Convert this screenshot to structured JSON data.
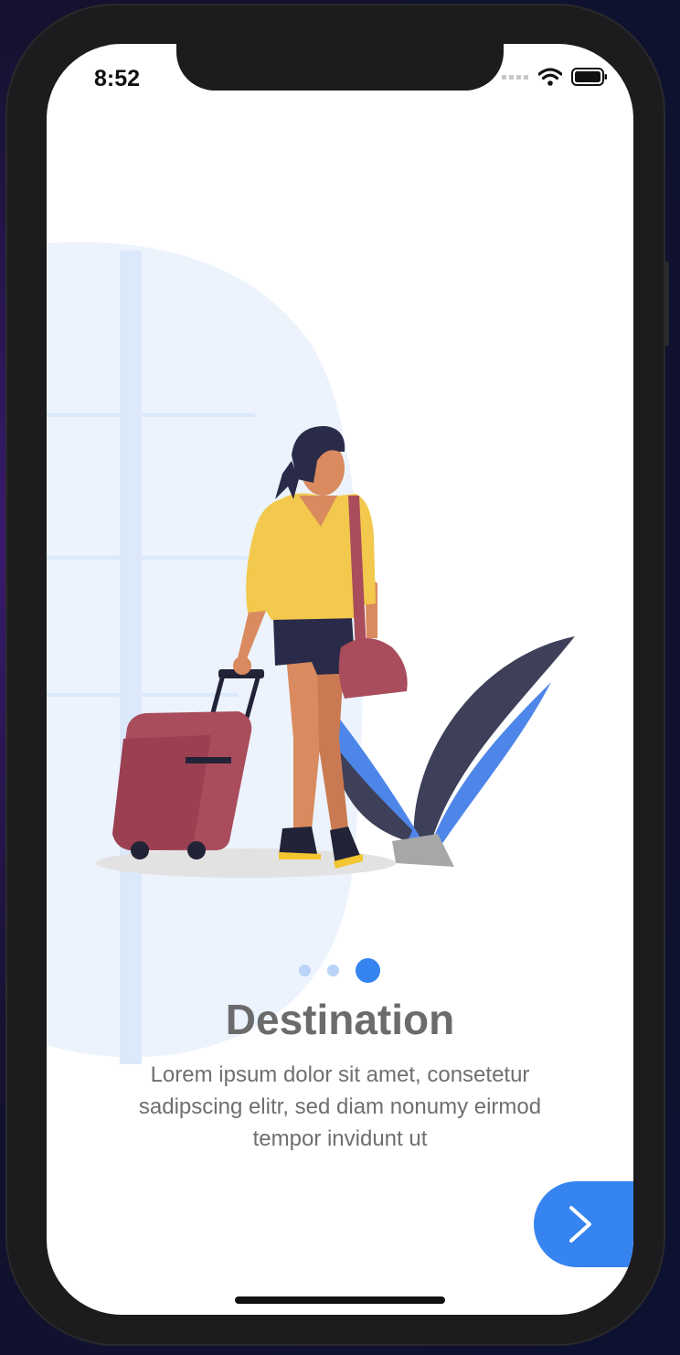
{
  "status_bar": {
    "time": "8:52"
  },
  "onboarding": {
    "page_indicator": {
      "total": 3,
      "active_index": 2
    },
    "title": "Destination",
    "description": "Lorem ipsum dolor sit amet, consetetur sadipscing elitr, sed diam nonumy eirmod tempor invidunt ut"
  },
  "next_button": {
    "icon": "chevron-right-icon"
  },
  "colors": {
    "accent": "#3584F0",
    "title_text": "#6B6B6B",
    "body_text": "#6F6F6F",
    "dot_inactive": "#B9D4F7"
  }
}
